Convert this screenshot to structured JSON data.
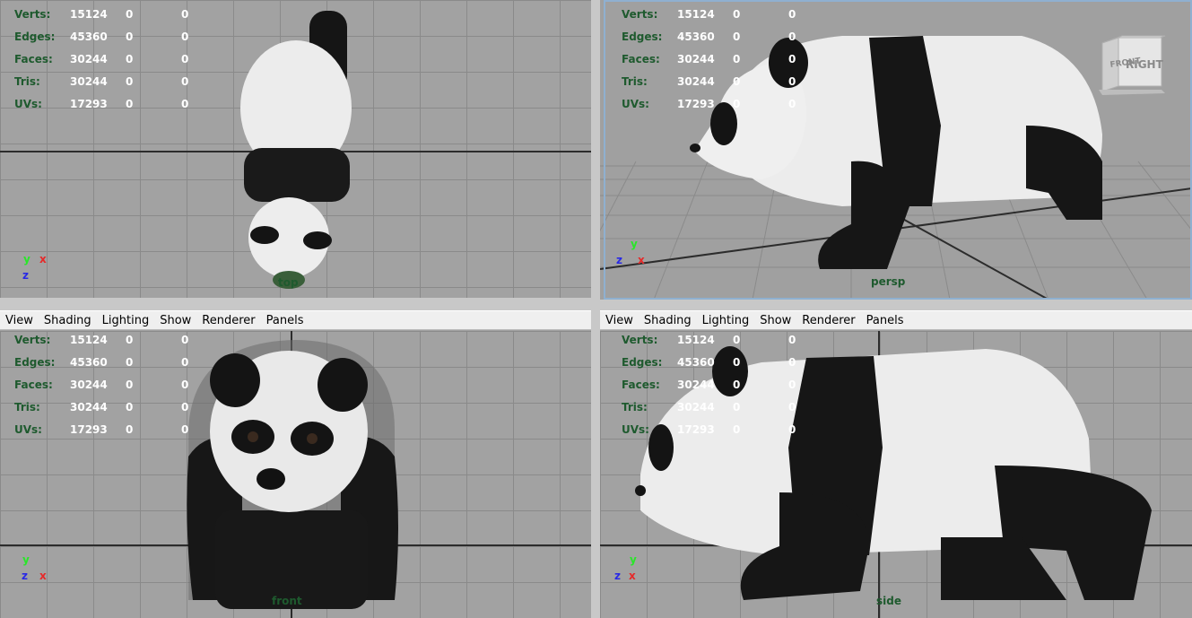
{
  "menu": [
    "View",
    "Shading",
    "Lighting",
    "Show",
    "Renderer",
    "Panels"
  ],
  "hud": {
    "rows": [
      {
        "label": "Verts:",
        "v1": "15124",
        "v2": "0",
        "v3": "0"
      },
      {
        "label": "Edges:",
        "v1": "45360",
        "v2": "0",
        "v3": "0"
      },
      {
        "label": "Faces:",
        "v1": "30244",
        "v2": "0",
        "v3": "0"
      },
      {
        "label": "Tris:",
        "v1": "30244",
        "v2": "0",
        "v3": "0"
      },
      {
        "label": "UVs:",
        "v1": "17293",
        "v2": "0",
        "v3": "0"
      }
    ]
  },
  "panes": {
    "top": {
      "camera": "top"
    },
    "persp": {
      "camera": "persp",
      "viewcube_front": "FRONT",
      "viewcube_right": "RIGHT"
    },
    "front": {
      "camera": "front"
    },
    "side": {
      "camera": "side"
    }
  },
  "axes": {
    "x": "x",
    "y": "y",
    "z": "z"
  },
  "colors": {
    "hud_label": "#1e5a2e",
    "axis_x": "#e62929",
    "axis_y": "#29e629",
    "axis_z": "#2929e6",
    "viewport_bg": "#a2a2a2"
  }
}
